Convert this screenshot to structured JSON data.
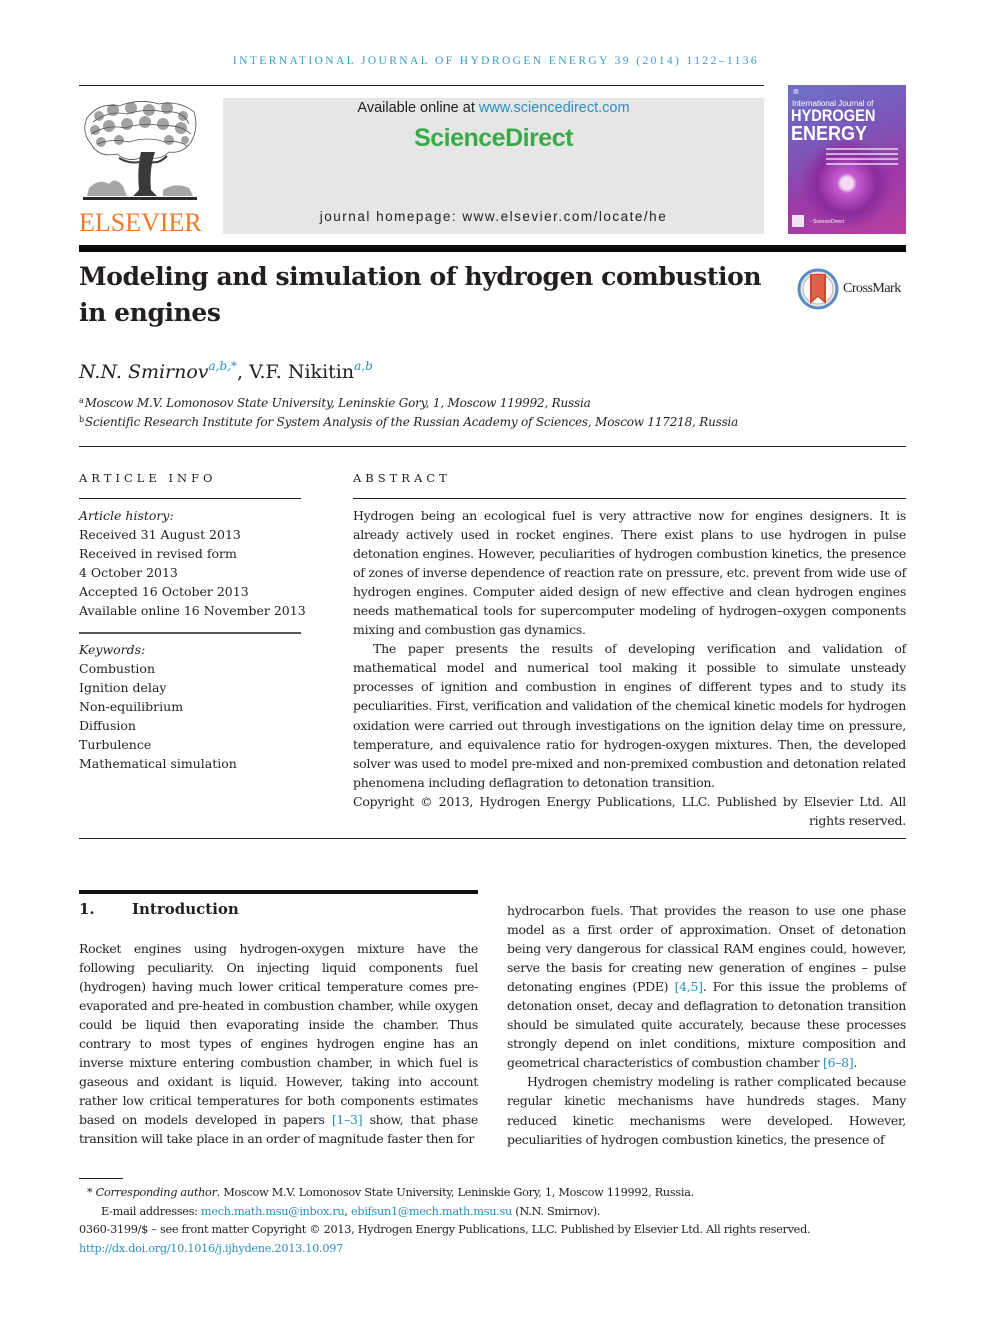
{
  "running_header": "INTERNATIONAL JOURNAL OF HYDROGEN ENERGY 39 (2014) 1122–1136",
  "masthead": {
    "publisher_logo": "ELSEVIER",
    "available_online_prefix": "Available online at ",
    "available_online_link": "www.sciencedirect.com",
    "brand": "ScienceDirect",
    "homepage": "journal homepage: www.elsevier.com/locate/he",
    "cover": {
      "line1": "International Journal of",
      "line2": "HYDROGEN",
      "line3": "ENERGY"
    },
    "colors": {
      "elsevier_orange": "#f07a2a",
      "sciencedirect_green": "#3aaa48",
      "link_blue": "#2a8fc0"
    }
  },
  "article": {
    "title": "Modeling and simulation of hydrogen combustion in engines",
    "crossmark_label": "CrossMark",
    "authors": [
      {
        "name": "N.N. Smirnov",
        "sup": "a,b,*"
      },
      {
        "name": "V.F. Nikitin",
        "sup": "a,b"
      }
    ],
    "affiliations": [
      {
        "key": "a",
        "text": "Moscow M.V. Lomonosov State University, Leninskie Gory, 1, Moscow 119992, Russia"
      },
      {
        "key": "b",
        "text": "Scientific Research Institute for System Analysis of the Russian Academy of Sciences, Moscow 117218, Russia"
      }
    ]
  },
  "article_info": {
    "heading": "ARTICLE INFO",
    "history_label": "Article history:",
    "history": [
      "Received 31 August 2013",
      "Received in revised form",
      "4 October 2013",
      "Accepted 16 October 2013",
      "Available online 16 November 2013"
    ],
    "keywords_label": "Keywords:",
    "keywords": [
      "Combustion",
      "Ignition delay",
      "Non-equilibrium",
      "Diffusion",
      "Turbulence",
      "Mathematical simulation"
    ]
  },
  "abstract": {
    "heading": "ABSTRACT",
    "paragraphs": [
      "Hydrogen being an ecological fuel is very attractive now for engines designers. It is already actively used in rocket engines. There exist plans to use hydrogen in pulse detonation engines. However, peculiarities of hydrogen combustion kinetics, the presence of zones of inverse dependence of reaction rate on pressure, etc. prevent from wide use of hydrogen engines. Computer aided design of new effective and clean hydrogen engines needs mathematical tools for supercomputer modeling of hydrogen–oxygen components mixing and combustion gas dynamics.",
      "The paper presents the results of developing verification and validation of mathematical model and numerical tool making it possible to simulate unsteady processes of ignition and combustion in engines of different types and to study its peculiarities. First, verification and validation of the chemical kinetic models for hydrogen oxidation were carried out through investigations on the ignition delay time on pressure, temperature, and equivalence ratio for hydrogen-oxygen mixtures. Then, the developed solver was used to model pre-mixed and non-premixed combustion and detonation related phenomena including deflagration to detonation transition."
    ],
    "copyright": "Copyright © 2013, Hydrogen Energy Publications, LLC. Published by Elsevier Ltd. All rights reserved."
  },
  "introduction": {
    "number": "1.",
    "title": "Introduction",
    "left_p1_a": "Rocket engines using hydrogen-oxygen mixture have the following peculiarity. On injecting liquid components fuel (hydrogen) having much lower critical temperature comes pre-evaporated and pre-heated in combustion chamber, while oxygen could be liquid then evaporating inside the chamber. Thus contrary to most types of engines hydrogen engine has an inverse mixture entering combustion chamber, in which fuel is gaseous and oxidant is liquid. However, taking into account rather low critical temperatures for both components estimates based on models developed in papers ",
    "left_p1_ref": "[1–3]",
    "left_p1_b": " show, that phase transition will take place in an order of magnitude faster then for",
    "right_p1_a": "hydrocarbon fuels. That provides the reason to use one phase model as a first order of approximation. Onset of detonation being very dangerous for classical RAM engines could, however, serve the basis for creating new generation of engines – pulse detonating engines (PDE) ",
    "right_p1_ref1": "[4,5]",
    "right_p1_b": ". For this issue the problems of detonation onset, decay and deflagration to detonation transition should be simulated quite accurately, because these processes strongly depend on inlet conditions, mixture composition and geometrical characteristics of combustion chamber ",
    "right_p1_ref2": "[6–8]",
    "right_p1_c": ".",
    "right_p2": "Hydrogen chemistry modeling is rather complicated because regular kinetic mechanisms have hundreds stages. Many reduced kinetic mechanisms were developed. However, peculiarities of hydrogen combustion kinetics, the presence of"
  },
  "footnotes": {
    "corresponding_mark": "*",
    "corresponding_label": "Corresponding author",
    "corresponding_text": ". Moscow M.V. Lomonosov State University, Leninskie Gory, 1, Moscow 119992, Russia.",
    "email_label": "E-mail addresses: ",
    "email_1": "mech.math.msu@inbox.ru",
    "email_sep": ", ",
    "email_2": "ebifsun1@mech.math.msu.su",
    "email_owner": " (N.N. Smirnov).",
    "issn_line": "0360-3199/$ – see front matter Copyright © 2013, Hydrogen Energy Publications, LLC. Published by Elsevier Ltd. All rights reserved.",
    "doi": "http://dx.doi.org/10.1016/j.ijhydene.2013.10.097"
  }
}
